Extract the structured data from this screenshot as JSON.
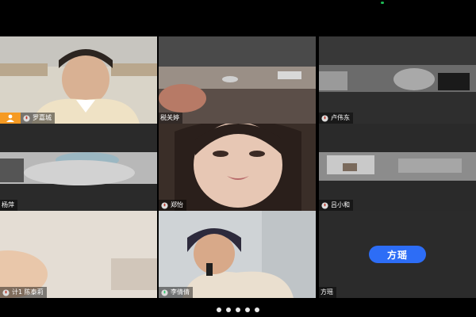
{
  "participants": [
    {
      "name": "罗嘉城",
      "badge": "host"
    },
    {
      "name": "税关婷"
    },
    {
      "name": "卢伟东"
    },
    {
      "name": "杨萍"
    },
    {
      "name": "郑怡"
    },
    {
      "name": "吕小和"
    },
    {
      "name": "计1 陈泰莉"
    },
    {
      "name": "李倩倩",
      "active": true
    },
    {
      "name": "方瑶",
      "avatar_text": "方瑶",
      "video": false
    }
  ],
  "colors": {
    "accent_active": "#2ecc71",
    "avatar_bg": "#2d6df6",
    "host_badge": "#f59a23"
  },
  "icons": {
    "mic": "mic-icon",
    "host": "person-icon"
  }
}
